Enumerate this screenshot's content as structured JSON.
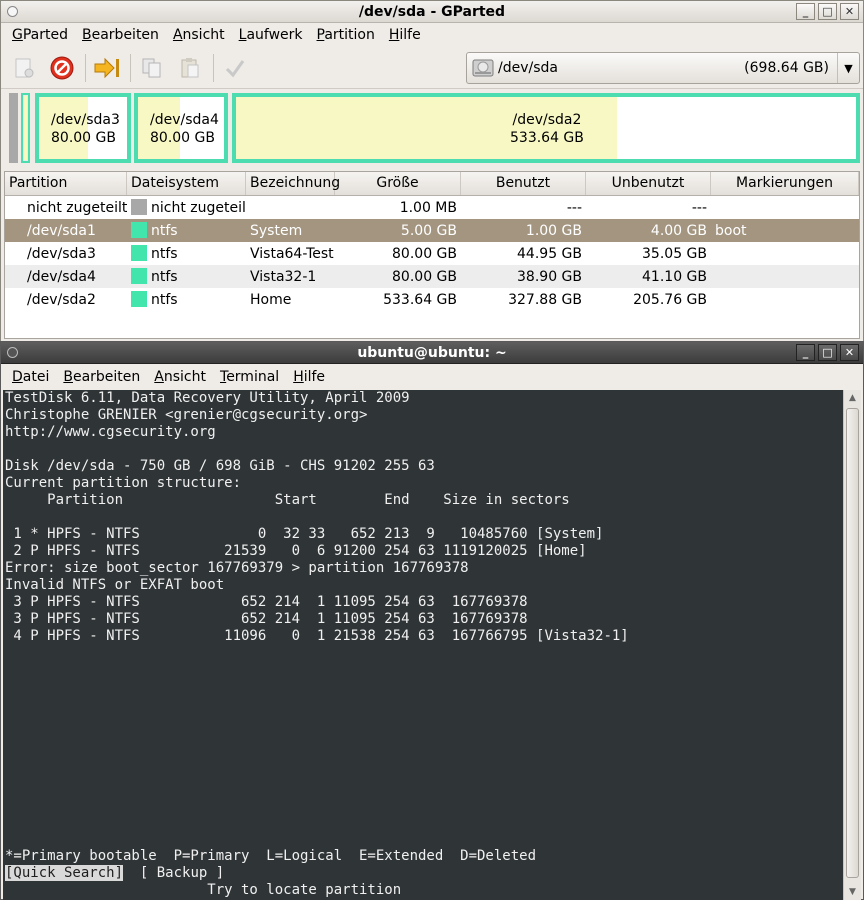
{
  "gparted": {
    "title": "/dev/sda - GParted",
    "menu": [
      {
        "u": "G",
        "rest": "Parted"
      },
      {
        "u": "B",
        "rest": "earbeiten"
      },
      {
        "u": "A",
        "rest": "nsicht"
      },
      {
        "u": "L",
        "rest": "aufwerk"
      },
      {
        "u": "P",
        "rest": "artition"
      },
      {
        "u": "H",
        "rest": "ilfe"
      }
    ],
    "toolbar_icons": [
      "new-partition-icon",
      "delete-icon",
      "resize-move-icon",
      "copy-icon",
      "paste-icon",
      "apply-icon"
    ],
    "device": {
      "name": "/dev/sda",
      "size": "(698.64 GB)"
    },
    "map": {
      "sda3": {
        "name": "/dev/sda3",
        "size": "80.00 GB",
        "used_fraction": 0.562
      },
      "sda4": {
        "name": "/dev/sda4",
        "size": "80.00 GB",
        "used_fraction": 0.486
      },
      "sda2": {
        "name": "/dev/sda2",
        "size": "533.64 GB",
        "used_fraction": 0.614
      }
    },
    "columns": [
      "Partition",
      "Dateisystem",
      "Bezeichnung",
      "Größe",
      "Benutzt",
      "Unbenutzt",
      "Markierungen"
    ],
    "rows": [
      {
        "partition": "nicht zugeteilt",
        "fs": "nicht zugeteilt",
        "fs_color": "#a8a8a8",
        "label": "",
        "size": "1.00 MB",
        "used": "---",
        "unused": "---",
        "flags": ""
      },
      {
        "partition": "/dev/sda1",
        "fs": "ntfs",
        "fs_color": "#42e5ac",
        "label": "System",
        "size": "5.00 GB",
        "used": "1.00 GB",
        "unused": "4.00 GB",
        "flags": "boot"
      },
      {
        "partition": "/dev/sda3",
        "fs": "ntfs",
        "fs_color": "#42e5ac",
        "label": "Vista64-Test",
        "size": "80.00 GB",
        "used": "44.95 GB",
        "unused": "35.05 GB",
        "flags": ""
      },
      {
        "partition": "/dev/sda4",
        "fs": "ntfs",
        "fs_color": "#42e5ac",
        "label": "Vista32-1",
        "size": "80.00 GB",
        "used": "38.90 GB",
        "unused": "41.10 GB",
        "flags": ""
      },
      {
        "partition": "/dev/sda2",
        "fs": "ntfs",
        "fs_color": "#42e5ac",
        "label": "Home",
        "size": "533.64 GB",
        "used": "327.88 GB",
        "unused": "205.76 GB",
        "flags": ""
      }
    ]
  },
  "terminal": {
    "title": "ubuntu@ubuntu: ~",
    "menu": [
      {
        "u": "D",
        "rest": "atei"
      },
      {
        "u": "B",
        "rest": "earbeiten"
      },
      {
        "u": "A",
        "rest": "nsicht"
      },
      {
        "u": "T",
        "rest": "erminal"
      },
      {
        "u": "H",
        "rest": "ilfe"
      }
    ],
    "lines": [
      "TestDisk 6.11, Data Recovery Utility, April 2009",
      "Christophe GRENIER <grenier@cgsecurity.org>",
      "http://www.cgsecurity.org",
      "",
      "Disk /dev/sda - 750 GB / 698 GiB - CHS 91202 255 63",
      "Current partition structure:",
      "     Partition                  Start        End    Size in sectors",
      "",
      " 1 * HPFS - NTFS              0  32 33   652 213  9   10485760 [System]",
      " 2 P HPFS - NTFS          21539   0  6 91200 254 63 1119120025 [Home]",
      "Error: size boot_sector 167769379 > partition 167769378",
      "Invalid NTFS or EXFAT boot",
      " 3 P HPFS - NTFS            652 214  1 11095 254 63  167769378",
      " 3 P HPFS - NTFS            652 214  1 11095 254 63  167769378",
      " 4 P HPFS - NTFS          11096   0  1 21538 254 63  167766795 [Vista32-1]"
    ],
    "legend": "*=Primary bootable  P=Primary  L=Logical  E=Extended  D=Deleted",
    "action_selected": "[Quick Search]",
    "action_other": "  [ Backup ]",
    "hint": "                        Try to locate partition"
  }
}
